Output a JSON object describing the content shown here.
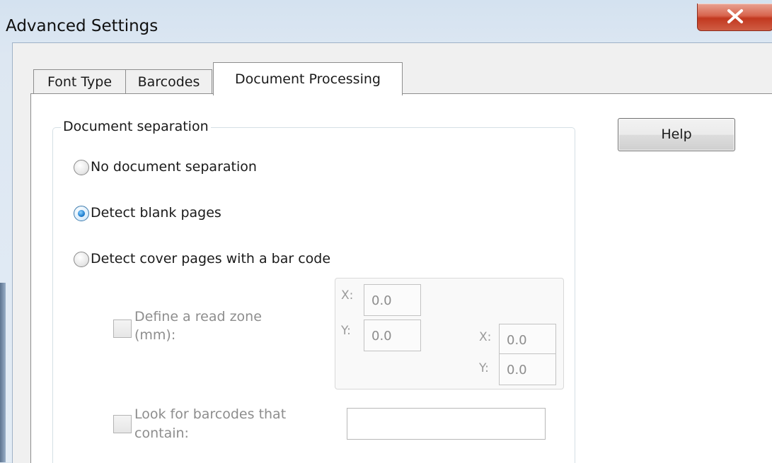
{
  "window": {
    "title": "Advanced Settings"
  },
  "tabs": [
    {
      "label": "Font Type",
      "active": false
    },
    {
      "label": "Barcodes",
      "active": false
    },
    {
      "label": "Document Processing",
      "active": true
    }
  ],
  "separation": {
    "legend": "Document separation",
    "options": [
      {
        "label": "No document separation",
        "checked": false
      },
      {
        "label": "Detect blank pages",
        "checked": true
      },
      {
        "label": "Detect cover pages with a bar code",
        "checked": false
      }
    ],
    "read_zone": {
      "label_line1": "Define a read zone",
      "label_line2": "(mm):",
      "checked": false,
      "coords": [
        {
          "label": "X:",
          "value": "0.0"
        },
        {
          "label": "Y:",
          "value": "0.0"
        },
        {
          "label": "X:",
          "value": "0.0"
        },
        {
          "label": "Y:",
          "value": "0.0"
        }
      ]
    },
    "contains": {
      "label_line1": "Look for barcodes that",
      "label_line2": "contain:",
      "checked": false,
      "value": ""
    }
  },
  "buttons": {
    "help": "Help"
  },
  "icons": {
    "close": "close-icon"
  },
  "colors": {
    "accent": "#1f7fd1",
    "close": "#c2381f"
  }
}
